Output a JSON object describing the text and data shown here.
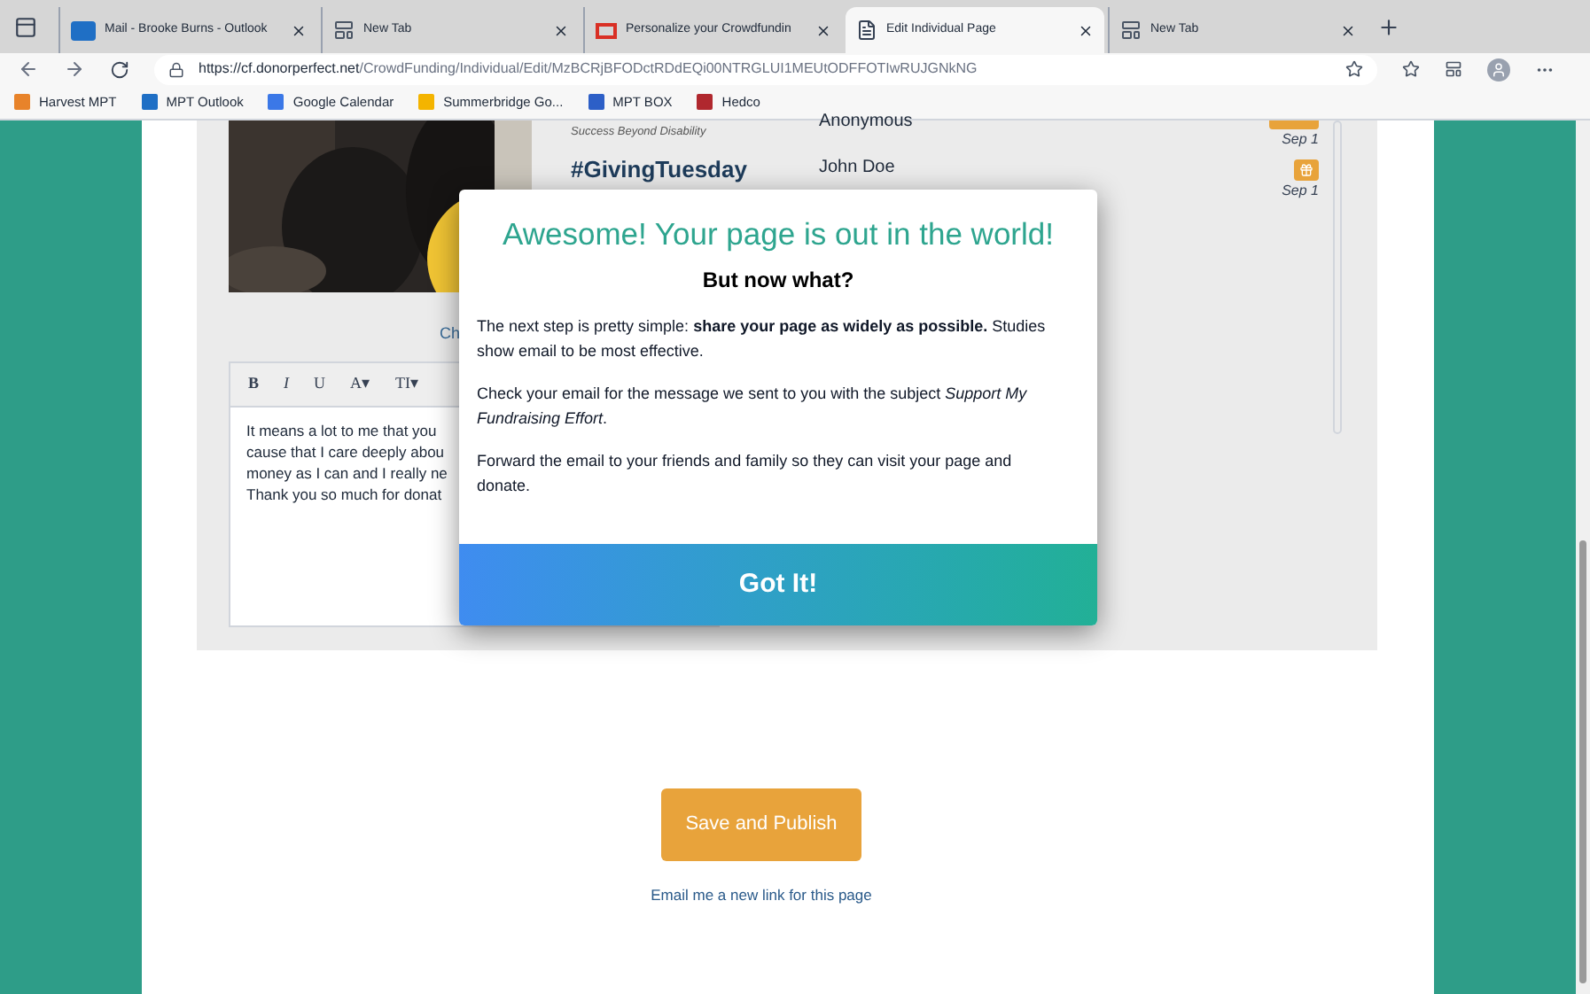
{
  "browser": {
    "tabs": [
      {
        "title": "Mail - Brooke Burns - Outlook",
        "kind": "outlook",
        "selected": false
      },
      {
        "title": "New Tab",
        "kind": "newtab",
        "selected": false
      },
      {
        "title": "Personalize your Crowdfundin",
        "kind": "gmail",
        "selected": false
      },
      {
        "title": "Edit Individual Page",
        "kind": "page",
        "selected": true
      },
      {
        "title": "New Tab",
        "kind": "newtab",
        "selected": false
      }
    ],
    "address_host": "https://cf.donorperfect.net",
    "address_path": "/CrowdFunding/Individual/Edit/MzBCRjBFODctRDdEQi00NTRGLUI1MEUtODFFOTIwRUJGNkNG",
    "bookmarks": [
      {
        "label": "Harvest MPT",
        "color": "#e8832a"
      },
      {
        "label": "MPT Outlook",
        "color": "#1f6fc5"
      },
      {
        "label": "Google Calendar",
        "color": "#3b78e7"
      },
      {
        "label": "Summerbridge Go...",
        "color": "#f4b400"
      },
      {
        "label": "MPT BOX",
        "color": "#2d5fc7"
      },
      {
        "label": "Hedco",
        "color": "#b0282e"
      }
    ]
  },
  "page": {
    "graphic_caption": "Success Beyond Disability",
    "graphic_hashtag": "#GivingTuesday",
    "change_link": "Ch",
    "editor": {
      "toolbar": [
        "B",
        "I",
        "U",
        "A▾",
        "TI▾"
      ],
      "lines": [
        "It means a lot to me that you",
        "cause that I care deeply abou",
        "money as I can and I really ne",
        "Thank you so much for donat"
      ]
    },
    "donors": [
      {
        "name": "Anonymous",
        "kind": "amount",
        "date": "Sep 1"
      },
      {
        "name": "John Doe",
        "kind": "gift",
        "date": "Sep 1"
      }
    ],
    "save_button": "Save and Publish",
    "email_link": "Email me a new link for this page"
  },
  "modal": {
    "title": "Awesome! Your page is out in the world!",
    "subtitle": "But now what?",
    "paragraphs": [
      "The next step is pretty simple: **share your page as widely as possible.** Studies show email to be most effective.",
      "Check your email for the message we sent to you with the subject *Support My Fundraising Effort*.",
      "Forward the email to your friends and family so they can visit your page and donate."
    ],
    "button": "Got It!"
  }
}
